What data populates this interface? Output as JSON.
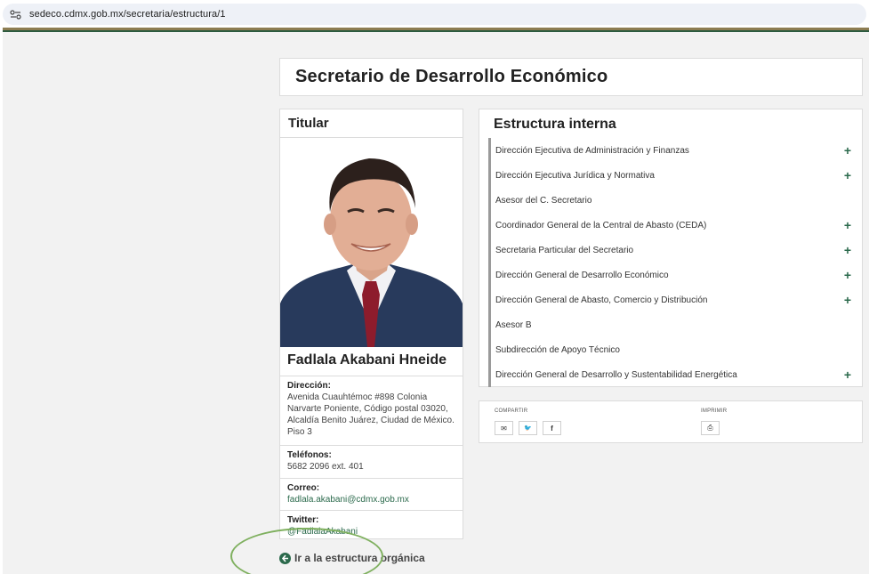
{
  "browser": {
    "url": "sedeco.cdmx.gob.mx/secretaria/estructura/1"
  },
  "page_title": "Secretario de Desarrollo Económico",
  "titular": {
    "heading": "Titular",
    "name": "Fadlala Akabani Hneide",
    "direccion_label": "Dirección:",
    "direccion_value": "Avenida Cuauhtémoc #898 Colonia Narvarte Poniente, Código postal 03020, Alcaldía Benito Juárez, Ciudad de México. Piso 3",
    "telefonos_label": "Teléfonos:",
    "telefonos_value": "5682 2096 ext. 401",
    "correo_label": "Correo:",
    "correo_value": "fadlala.akabani@cdmx.gob.mx",
    "twitter_label": "Twitter:",
    "twitter_value": "@FadlalaAkabani"
  },
  "estructura": {
    "heading": "Estructura interna",
    "items": [
      {
        "label": "Dirección Ejecutiva de Administración y Finanzas",
        "expandable": true
      },
      {
        "label": "Dirección Ejecutiva Jurídica y Normativa",
        "expandable": true
      },
      {
        "label": "Asesor del C. Secretario",
        "expandable": false
      },
      {
        "label": "Coordinador General de la Central de Abasto (CEDA)",
        "expandable": true
      },
      {
        "label": "Secretaria Particular del Secretario",
        "expandable": true
      },
      {
        "label": "Dirección General de Desarrollo Económico",
        "expandable": true
      },
      {
        "label": "Dirección General de Abasto, Comercio y Distribución",
        "expandable": true
      },
      {
        "label": "Asesor B",
        "expandable": false
      },
      {
        "label": "Subdirección de Apoyo Técnico",
        "expandable": false
      },
      {
        "label": "Dirección General de Desarrollo y Sustentabilidad Energética",
        "expandable": true
      }
    ]
  },
  "share": {
    "compartir_label": "COMPARTIR",
    "imprimir_label": "IMPRIMIR",
    "email_glyph": "✉",
    "twitter_glyph": "🐦",
    "facebook_glyph": "f",
    "print_glyph": "⎙"
  },
  "organica_link": "Ir a la estructura orgánica",
  "colors": {
    "accent_green": "#2b6a4c",
    "highlight": "#7fb05f",
    "stripe_gold": "#8d7d52"
  }
}
